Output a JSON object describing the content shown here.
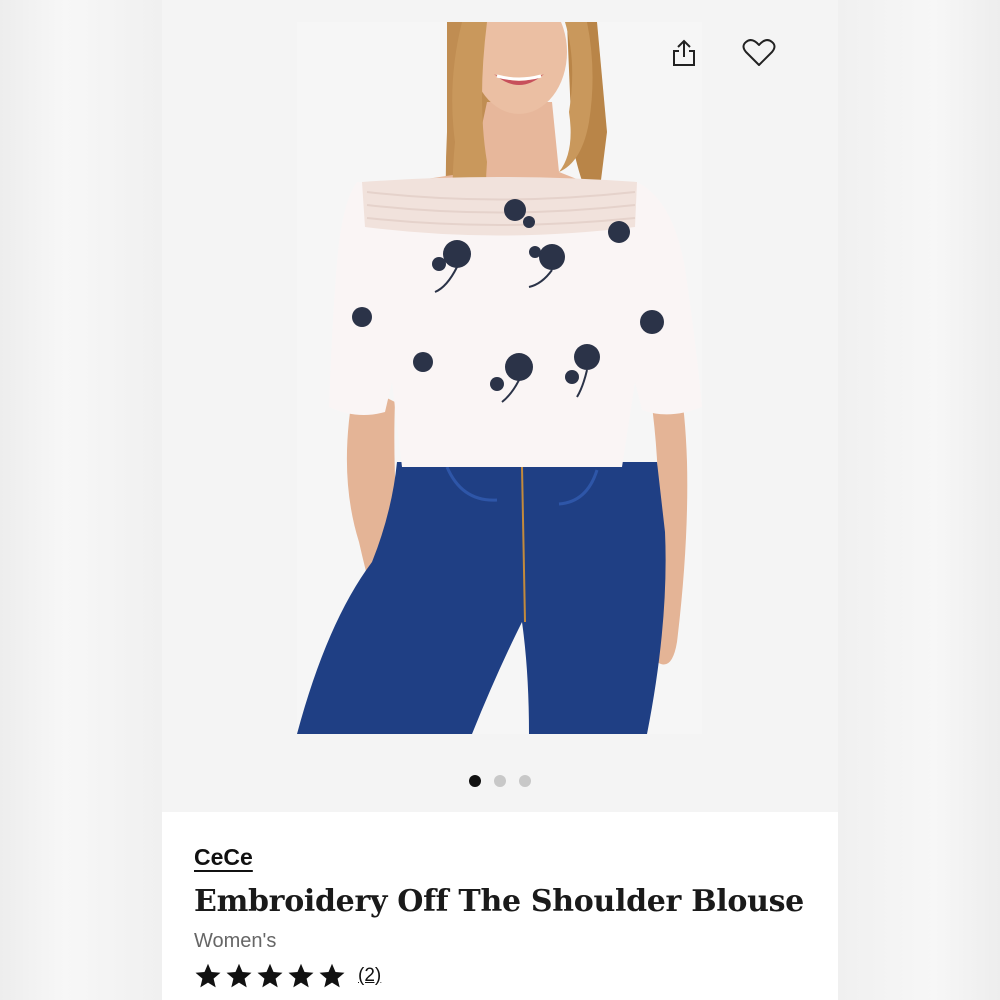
{
  "product": {
    "brand": "CeCe",
    "title": "Embroidery Off The Shoulder Blouse",
    "category": "Women's",
    "rating": 5,
    "max_rating": 5,
    "review_count": "(2)"
  },
  "gallery": {
    "image_count": 3,
    "active_index": 0
  },
  "actions": {
    "share_icon": "share-icon",
    "favorite_icon": "heart-icon"
  },
  "colors": {
    "top": "#faf5f5",
    "embroidery": "#2b3348",
    "denim": "#1f3f84",
    "hair": "#c08d52",
    "skin": "#e7b79b"
  }
}
